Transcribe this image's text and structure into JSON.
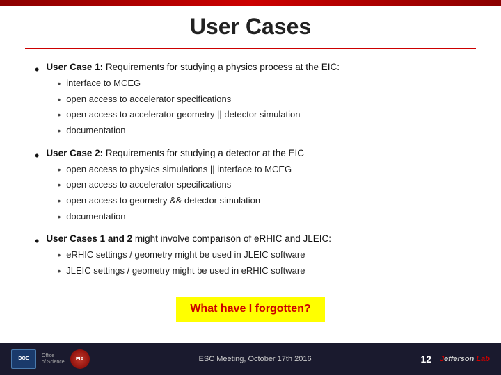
{
  "slide": {
    "title": "User Cases",
    "top_bar_color": "#cc0000",
    "bullets": [
      {
        "id": "uc1",
        "label": "User Case 1:",
        "text": " Requirements for studying a physics process at the EIC:",
        "sub": [
          "interface to MCEG",
          "open access to accelerator specifications",
          "open access to accelerator geometry || detector simulation",
          "documentation"
        ]
      },
      {
        "id": "uc2",
        "label": "User Case 2:",
        "text": " Requirements for studying a detector at the EIC",
        "sub": [
          "open access to physics simulations || interface to MCEG",
          "open access to accelerator specifications",
          "open access to geometry && detector simulation",
          "documentation"
        ]
      },
      {
        "id": "uc12",
        "label": "User Cases 1 and 2",
        "text": " might involve comparison of eRHIC and JLEIC:",
        "sub": [
          "eRHIC settings / geometry might be used in JLEIC software",
          "JLEIC settings / geometry might be used in eRHIC software"
        ]
      }
    ],
    "highlight": "What have I forgotten?",
    "footer": {
      "meeting": "ESC Meeting, October 17th 2016",
      "page": "12",
      "lab": "Jefferson Lab"
    }
  }
}
